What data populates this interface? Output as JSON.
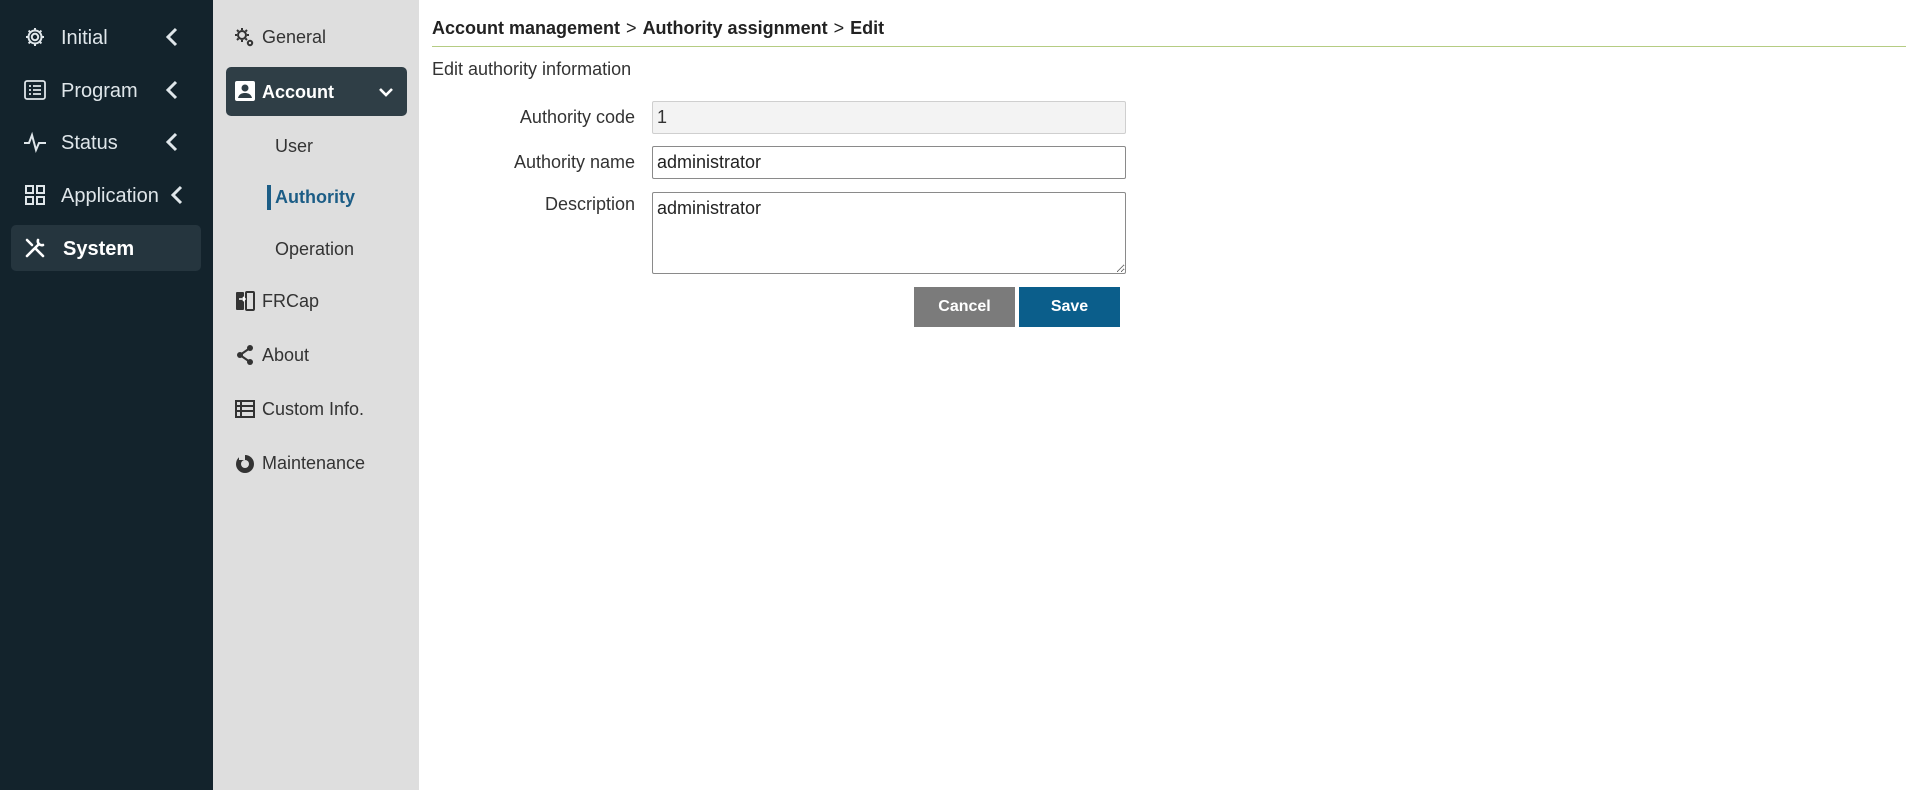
{
  "primary_nav": {
    "items": [
      {
        "label": "Initial",
        "icon": "gear-icon"
      },
      {
        "label": "Program",
        "icon": "list-icon"
      },
      {
        "label": "Status",
        "icon": "pulse-icon"
      },
      {
        "label": "Application",
        "icon": "grid-icon"
      },
      {
        "label": "System",
        "icon": "tools-icon",
        "active": true
      }
    ]
  },
  "secondary_nav": {
    "items": [
      {
        "label": "General",
        "icon": "gears-icon"
      },
      {
        "label": "Account",
        "icon": "user-badge-icon",
        "active": true
      },
      {
        "label": "FRCap",
        "icon": "frcap-icon"
      },
      {
        "label": "About",
        "icon": "share-icon"
      },
      {
        "label": "Custom Info.",
        "icon": "table-icon"
      },
      {
        "label": "Maintenance",
        "icon": "maintenance-icon"
      }
    ],
    "account_sub": [
      {
        "label": "User"
      },
      {
        "label": "Authority",
        "active": true
      },
      {
        "label": "Operation"
      }
    ]
  },
  "breadcrumb": {
    "part1": "Account management",
    "sep": ">",
    "part2": "Authority assignment",
    "part3": "Edit"
  },
  "form": {
    "subtitle": "Edit authority information",
    "authority_code_label": "Authority code",
    "authority_code_value": "1",
    "authority_name_label": "Authority name",
    "authority_name_value": "administrator",
    "description_label": "Description",
    "description_value": "administrator",
    "cancel_label": "Cancel",
    "save_label": "Save"
  },
  "colors": {
    "primary_nav_bg": "#13232c",
    "secondary_nav_bg": "#dedede",
    "accent": "#1c5d86",
    "save_button": "#0b5e8b",
    "cancel_button": "#7b7b7b",
    "title_rule": "#b5cc83"
  }
}
